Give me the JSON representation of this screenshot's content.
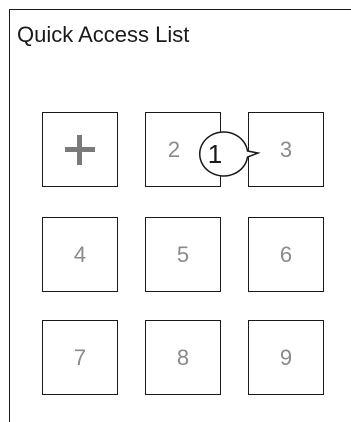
{
  "header": {
    "title": "Quick Access List"
  },
  "slots": [
    {
      "label": "",
      "icon": "plus-icon"
    },
    {
      "label": "2"
    },
    {
      "label": "3"
    },
    {
      "label": "4"
    },
    {
      "label": "5"
    },
    {
      "label": "6"
    },
    {
      "label": "7"
    },
    {
      "label": "8"
    },
    {
      "label": "9"
    }
  ],
  "callout": {
    "label": "1"
  },
  "colors": {
    "border": "#1a1a1a",
    "slot_text": "#8a8a8a",
    "background": "#ffffff"
  }
}
